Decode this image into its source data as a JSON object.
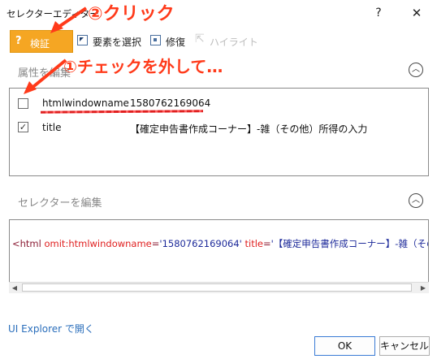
{
  "window": {
    "title": "セレクターエディター",
    "help_icon": "?",
    "close_icon": "✕"
  },
  "toolbar": {
    "validate_label": "検証",
    "validate_icon": "?",
    "select_element_label": "要素を選択",
    "repair_label": "修復",
    "highlight_label": "ハイライト"
  },
  "attributes": {
    "title": "属性を編集",
    "collapse_icon": "chevron-up",
    "rows": [
      {
        "checked": false,
        "name": "htmlwindowname",
        "value": "1580762169064"
      },
      {
        "checked": true,
        "name": "title",
        "value": "【確定申告書作成コーナー】-雑（その他）所得の入力"
      }
    ]
  },
  "selector": {
    "title": "セレクターを編集",
    "collapse_icon": "chevron-up",
    "tag_open": "<html ",
    "attr1": "omit:htmlwindowname",
    "eq1": "=",
    "val1": "'1580762169064'",
    "sp": " ",
    "attr2": "title",
    "eq2": "=",
    "val2": "'【確定申告書作成コーナー】-雑（その他）所得"
  },
  "footer": {
    "ui_explorer_link": "UI Explorer で開く",
    "ok_label": "OK",
    "cancel_label": "キャンセル"
  },
  "annotations": {
    "step2": "②クリック",
    "step1": "①チェックを外して…"
  },
  "colors": {
    "accent_orange": "#f5a623",
    "annotation_red": "#ff3a1a",
    "link_blue": "#2a6ebb"
  }
}
